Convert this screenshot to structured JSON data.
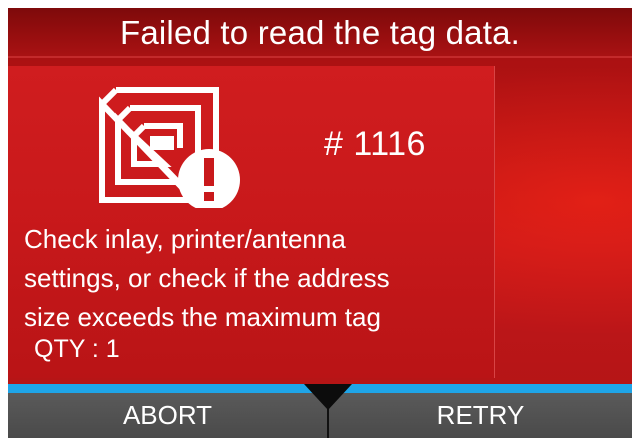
{
  "title": "Failed to read the tag data.",
  "error": {
    "icon": "rfid-tag-warning-icon",
    "code": "# 1116",
    "message_lines": [
      "Check inlay, printer/antenna",
      "settings, or check if the address",
      "size exceeds the maximum tag"
    ],
    "qty": "QTY : 1"
  },
  "softkeys": {
    "left_label": "ABORT",
    "right_label": "RETRY"
  },
  "colors": {
    "background": "#c3171a",
    "title_bar": "#980e0f",
    "accent": "#1fa5e8",
    "softkey": "#4f4f4f",
    "text": "#ffffff"
  }
}
